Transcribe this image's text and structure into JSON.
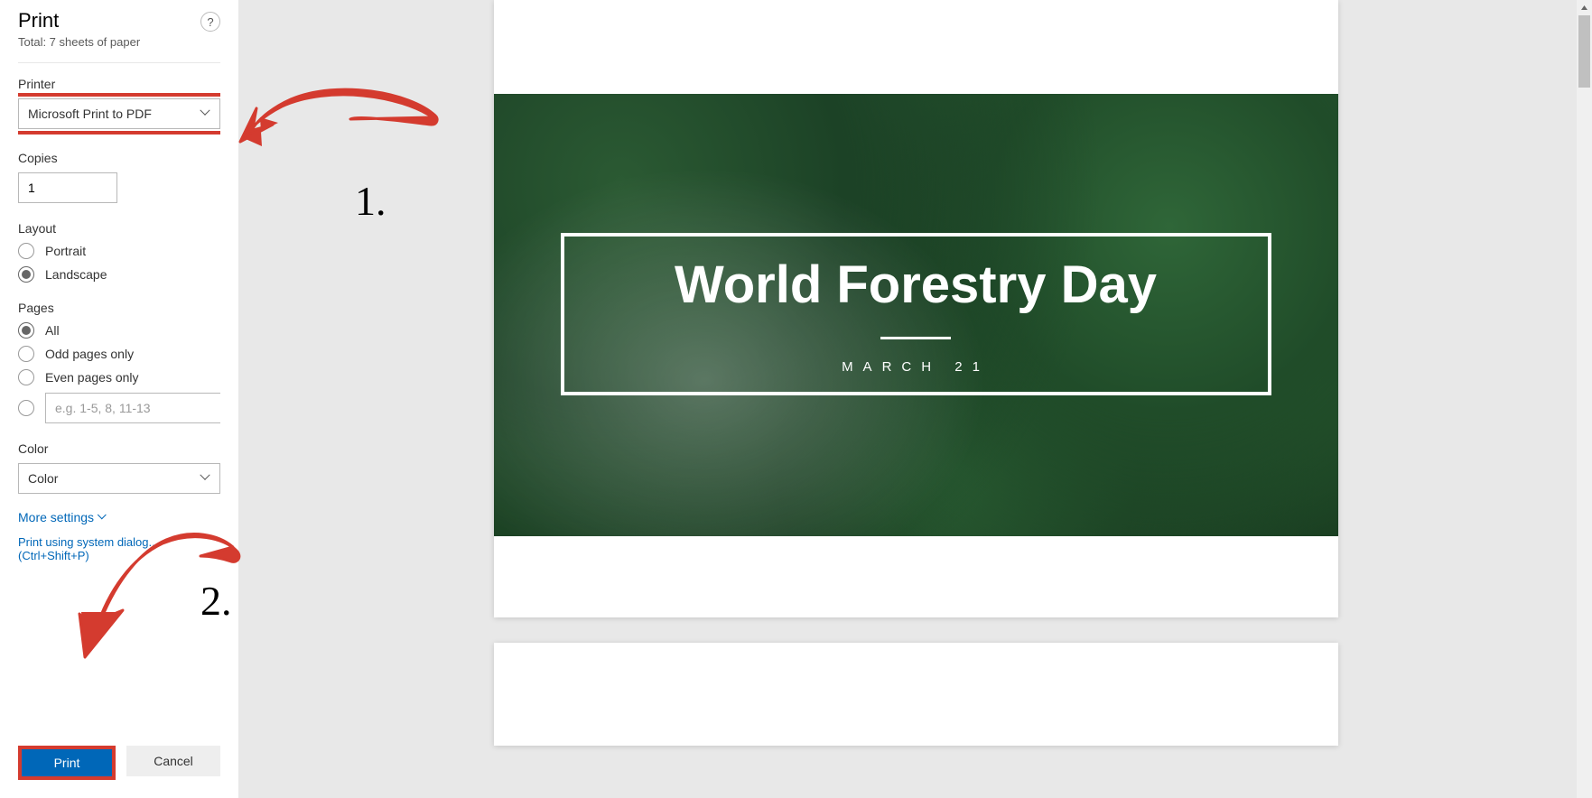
{
  "header": {
    "title": "Print",
    "subtitle": "Total: 7 sheets of paper",
    "help": "?"
  },
  "printer": {
    "label": "Printer",
    "selected": "Microsoft Print to PDF"
  },
  "copies": {
    "label": "Copies",
    "value": "1"
  },
  "layout": {
    "label": "Layout",
    "portrait": "Portrait",
    "landscape": "Landscape",
    "selected": "Landscape"
  },
  "pages": {
    "label": "Pages",
    "all": "All",
    "odd": "Odd pages only",
    "even": "Even pages only",
    "custom_placeholder": "e.g. 1-5, 8, 11-13",
    "selected": "All"
  },
  "color": {
    "label": "Color",
    "selected": "Color"
  },
  "links": {
    "more_settings": "More settings",
    "system_dialog": "Print using system dialog... (Ctrl+Shift+P)"
  },
  "buttons": {
    "print": "Print",
    "cancel": "Cancel"
  },
  "preview": {
    "hero_title": "World Forestry Day",
    "hero_date": "MARCH 21"
  },
  "annotations": {
    "num1": "1.",
    "num2": "2."
  }
}
